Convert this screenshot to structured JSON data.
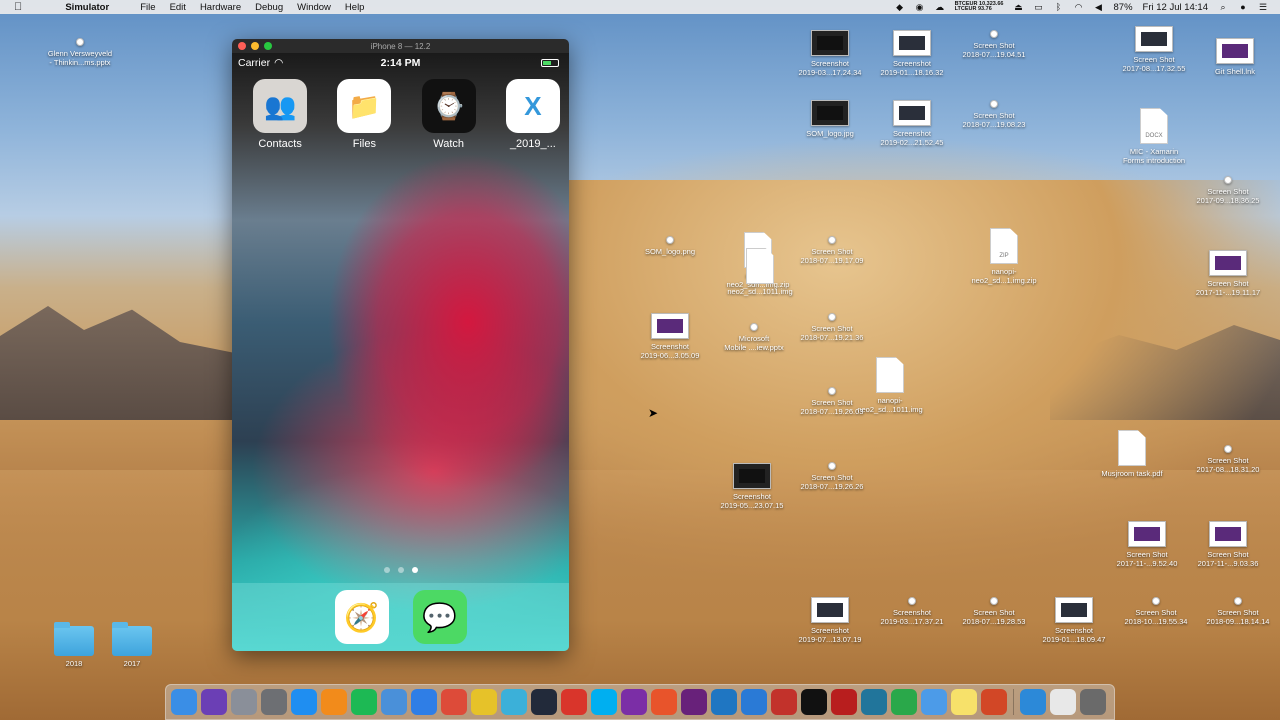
{
  "menubar": {
    "apple": "",
    "app": "Simulator",
    "items": [
      "File",
      "Edit",
      "Hardware",
      "Debug",
      "Window",
      "Help"
    ],
    "ticker_top": "BTCEUR 10,323.66",
    "ticker_bottom": "LTCEUR 93.76",
    "battery": "87%",
    "clock": "Fri 12 Jul  14:14"
  },
  "desktop": {
    "icons": [
      {
        "label": "Glenn Versweyveld\n- Thinkin...ms.pptx",
        "kind": "light"
      },
      {
        "label": "Screenshot\n2019-03...17.24.34",
        "kind": "dark-thumb"
      },
      {
        "label": "Screenshot\n2019-01...18.16.32",
        "kind": "thumb"
      },
      {
        "label": "Screen Shot\n2018-07...19.04.51",
        "kind": "light"
      },
      {
        "label": "Screen Shot\n2017-08...17.32.55",
        "kind": "thumb"
      },
      {
        "label": "Git Shell.lnk",
        "kind": "purple"
      },
      {
        "label": "SOM_logo.jpg",
        "kind": "dark-thumb"
      },
      {
        "label": "Screenshot\n2019-02...21.52.45",
        "kind": "thumb"
      },
      {
        "label": "Screen Shot\n2018-07...19.08.23",
        "kind": "light"
      },
      {
        "label": "MIC - Xamarin\nForms introduction",
        "kind": "doc",
        "doc_tag": "DOCX"
      },
      {
        "label": "Screen Shot\n2017-09...18.36.25",
        "kind": "light"
      },
      {
        "label": "SOM_logo.png",
        "kind": "light"
      },
      {
        "label": "nanopi-\nneo2_sdn...img.zip",
        "kind": "doc",
        "doc_tag": "ZIP"
      },
      {
        "label": "neo2_sd...1011.img",
        "kind": "doc",
        "doc_tag": ""
      },
      {
        "label": "Screen Shot\n2018-07...19.17.09",
        "kind": "light"
      },
      {
        "label": "nanopi-\nneo2_sd...1.img.zip",
        "kind": "doc",
        "doc_tag": "ZIP"
      },
      {
        "label": "Screen Shot\n2017-11-...19.11.17",
        "kind": "purple"
      },
      {
        "label": "Screenshot\n2019-06...3.05.09",
        "kind": "purple"
      },
      {
        "label": "Microsoft\nMobile ....iew.pptx",
        "kind": "light"
      },
      {
        "label": "Screen Shot\n2018-07...19.21.36",
        "kind": "light"
      },
      {
        "label": "nanopi-\nneo2_sd...1011.img",
        "kind": "doc",
        "doc_tag": ""
      },
      {
        "label": "Screen Shot\n2018-07...19.26.03",
        "kind": "light"
      },
      {
        "label": "Musjroom task.pdf",
        "kind": "doc",
        "doc_tag": ""
      },
      {
        "label": "Screen Shot\n2017-08...18.31.20",
        "kind": "light"
      },
      {
        "label": "Screenshot\n2019-05...23.07.15",
        "kind": "dark-thumb"
      },
      {
        "label": "Screen Shot\n2018-07...19.26.26",
        "kind": "light"
      },
      {
        "label": "Screen Shot\n2017-11-...9.52.40",
        "kind": "purple"
      },
      {
        "label": "Screen Shot\n2017-11-...9.03.36",
        "kind": "purple"
      },
      {
        "label": "Screenshot\n2019-07...13.07.19",
        "kind": "thumb"
      },
      {
        "label": "Screenshot\n2019-03...17.37.21",
        "kind": "light"
      },
      {
        "label": "Screen Shot\n2018-07...19.28.53",
        "kind": "light"
      },
      {
        "label": "Screenshot\n2019-01...18.09.47",
        "kind": "thumb"
      },
      {
        "label": "Screen Shot\n2018-10...19.55.34",
        "kind": "light"
      },
      {
        "label": "Screen Shot\n2018-09...18.14.14",
        "kind": "light"
      },
      {
        "label": "2018",
        "kind": "folder"
      },
      {
        "label": "2017",
        "kind": "folder"
      }
    ]
  },
  "simulator": {
    "title": "iPhone 8 — 12.2",
    "status": {
      "carrier": "Carrier",
      "time": "2:14 PM",
      "battery_level": 0.6
    },
    "apps": [
      {
        "label": "Contacts",
        "icon": "contacts-icon",
        "glyph": "👥",
        "color": "#d9d6d2"
      },
      {
        "label": "Files",
        "icon": "files-icon",
        "glyph": "📁",
        "color": "#ffffff"
      },
      {
        "label": "Watch",
        "icon": "watch-icon",
        "glyph": "⌚",
        "color": "#111111"
      },
      {
        "label": "_2019_...",
        "icon": "xamarin-icon",
        "glyph": "X",
        "color": "#ffffff"
      }
    ],
    "page_dots": 3,
    "active_dot": 2,
    "dock": [
      {
        "icon": "safari-icon",
        "glyph": "🧭",
        "color": "#ffffff"
      },
      {
        "icon": "messages-icon",
        "glyph": "💬",
        "color": "#4cd964"
      }
    ]
  },
  "dock": {
    "apps": [
      {
        "icon": "finder-icon",
        "color": "#3a8ee6"
      },
      {
        "icon": "siri-icon",
        "color": "#6b3fb5"
      },
      {
        "icon": "launchpad-icon",
        "color": "#8a8f99"
      },
      {
        "icon": "system-preferences-icon",
        "color": "#6d6f73"
      },
      {
        "icon": "app-store-icon",
        "color": "#1f8ef1"
      },
      {
        "icon": "books-icon",
        "color": "#f28b1b"
      },
      {
        "icon": "spotify-icon",
        "color": "#1db954"
      },
      {
        "icon": "lock-icon",
        "color": "#4a90d9"
      },
      {
        "icon": "safari-icon",
        "color": "#2f7ee6"
      },
      {
        "icon": "chrome-icon",
        "color": "#dd4b39"
      },
      {
        "icon": "dev-icon",
        "color": "#e6c229"
      },
      {
        "icon": "vpn-icon",
        "color": "#3bb0d9"
      },
      {
        "icon": "terminal-app-icon",
        "color": "#222a3a"
      },
      {
        "icon": "red-app-icon",
        "color": "#d9352b"
      },
      {
        "icon": "skype-icon",
        "color": "#00aff0"
      },
      {
        "icon": "onenote-icon",
        "color": "#7b2ea6"
      },
      {
        "icon": "brush-icon",
        "color": "#e8542b"
      },
      {
        "icon": "visual-studio-icon",
        "color": "#68217a"
      },
      {
        "icon": "vscode-icon",
        "color": "#1f76c2"
      },
      {
        "icon": "simulator-icon",
        "color": "#2a7ad6"
      },
      {
        "icon": "red-device-icon",
        "color": "#c2322b"
      },
      {
        "icon": "terminal-icon",
        "color": "#111111"
      },
      {
        "icon": "filezilla-icon",
        "color": "#b81e1e"
      },
      {
        "icon": "wordpress-icon",
        "color": "#21759b"
      },
      {
        "icon": "sourcetree-icon",
        "color": "#2aa84a"
      },
      {
        "icon": "cloud-icon",
        "color": "#4c9be8"
      },
      {
        "icon": "notes-icon",
        "color": "#f7e16a"
      },
      {
        "icon": "powerpoint-icon",
        "color": "#d24726"
      },
      {
        "icon": "folder-icon",
        "color": "#2c89d8"
      },
      {
        "icon": "document-icon",
        "color": "#e8e8e8"
      },
      {
        "icon": "trash-icon",
        "color": "#6a6a6a"
      }
    ]
  }
}
